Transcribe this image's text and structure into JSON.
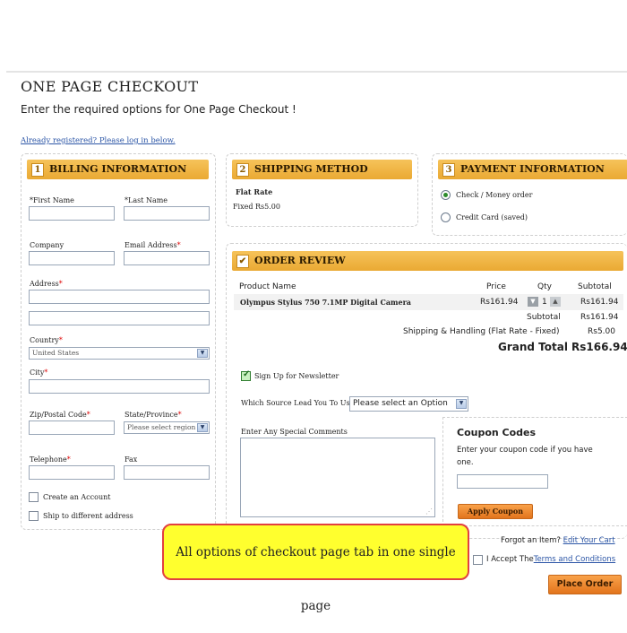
{
  "page": {
    "title": "ONE PAGE CHECKOUT",
    "subtitle": "Enter the required options for One Page Checkout !",
    "login_link": "Already registered? Please log in below."
  },
  "billing": {
    "number": "1",
    "header": "BILLING INFORMATION",
    "first_name": "*First Name",
    "last_name": "*Last Name",
    "company": "Company",
    "email": "Email Address",
    "address": "Address",
    "country": "Country",
    "country_value": "United States",
    "city": "City",
    "zip": "Zip/Postal Code",
    "state": "State/Province",
    "state_value": "Please select region",
    "telephone": "Telephone",
    "fax": "Fax",
    "create_account": "Create an Account",
    "ship_different": "Ship to different address",
    "asterisk": "*"
  },
  "shipping": {
    "number": "2",
    "header": "SHIPPING METHOD",
    "method_name": "Flat Rate",
    "method_price": "Fixed Rs5.00"
  },
  "payment": {
    "number": "3",
    "header": "PAYMENT INFORMATION",
    "option1": "Check / Money order",
    "option2": "Credit Card (saved)"
  },
  "review": {
    "header": "ORDER REVIEW",
    "col_product": "Product Name",
    "col_price": "Price",
    "col_qty": "Qty",
    "col_subtotal": "Subtotal",
    "item_name": "Olympus Stylus 750 7.1MP Digital Camera",
    "item_price": "Rs161.94",
    "item_qty": "1",
    "item_subtotal": "Rs161.94",
    "subtotal_label": "Subtotal",
    "subtotal_value": "Rs161.94",
    "shipping_label": "Shipping & Handling (Flat Rate - Fixed)",
    "shipping_value": "Rs5.00",
    "grand_label": "Grand Total",
    "grand_value": "Rs166.94",
    "newsletter": "Sign Up for Newsletter",
    "source_label": "Which Source Lead You To Us",
    "source_value": "Please select an Option",
    "comments_label": "Enter Any Special Comments"
  },
  "coupon": {
    "title": "Coupon Codes",
    "desc": "Enter your coupon code if you have one.",
    "button": "Apply Coupon"
  },
  "footer": {
    "forgot": "Forgot an Item?",
    "edit_cart": "Edit Your Cart",
    "accept": "I Accept The",
    "terms": "Terms and Conditions",
    "place_order": "Place Order"
  },
  "callout": "All options of checkout page tab in one single page",
  "colors": {
    "header_orange": "#eaa933",
    "button_orange": "#e2741c",
    "link_blue": "#2b55a6",
    "callout_yellow": "#ffff2e",
    "callout_border": "#e24040"
  }
}
